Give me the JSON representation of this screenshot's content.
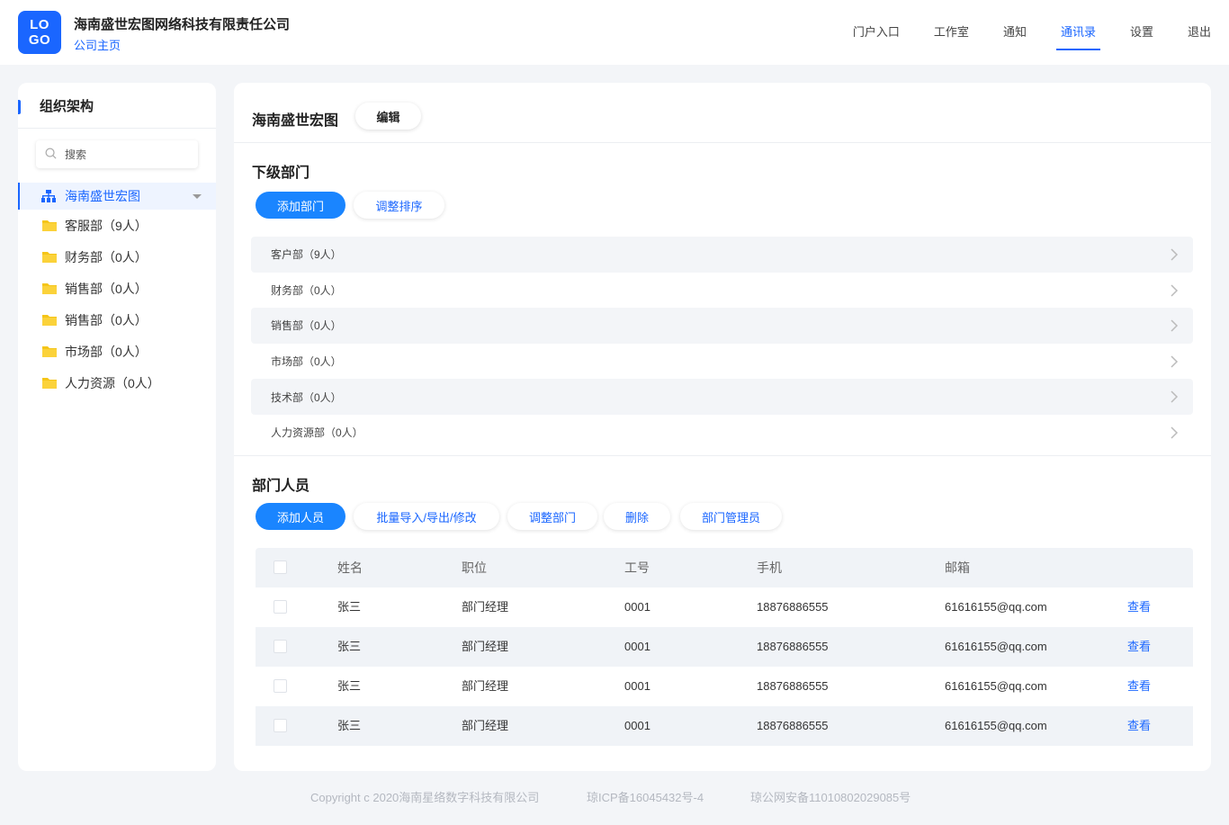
{
  "header": {
    "logo_line1": "LO",
    "logo_line2": "GO",
    "company_name": "海南盛世宏图网络科技有限责任公司",
    "company_home": "公司主页",
    "nav": [
      "门户入口",
      "工作室",
      "通知",
      "通讯录",
      "设置",
      "退出"
    ],
    "active_nav": "通讯录"
  },
  "sidebar": {
    "title": "组织架构",
    "search_placeholder": "搜索",
    "root": "海南盛世宏图",
    "items": [
      "客服部（9人）",
      "财务部（0人）",
      "销售部（0人）",
      "销售部（0人）",
      "市场部（0人）",
      "人力资源（0人）"
    ]
  },
  "main": {
    "title": "海南盛世宏图",
    "edit_label": "编辑",
    "sub_dept_title": "下级部门",
    "add_dept_label": "添加部门",
    "sort_label": "调整排序",
    "departments": [
      "客户部（9人）",
      "财务部（0人）",
      "销售部（0人）",
      "市场部（0人）",
      "技术部（0人）",
      "人力资源部（0人）"
    ],
    "members_title": "部门人员",
    "member_actions": [
      "添加人员",
      "批量导入/导出/修改",
      "调整部门",
      "删除",
      "部门管理员"
    ],
    "table": {
      "columns": [
        "姓名",
        "职位",
        "工号",
        "手机",
        "邮箱"
      ],
      "view_label": "查看",
      "rows": [
        {
          "name": "张三",
          "position": "部门经理",
          "id": "0001",
          "phone": "18876886555",
          "email": "61616155@qq.com"
        },
        {
          "name": "张三",
          "position": "部门经理",
          "id": "0001",
          "phone": "18876886555",
          "email": "61616155@qq.com"
        },
        {
          "name": "张三",
          "position": "部门经理",
          "id": "0001",
          "phone": "18876886555",
          "email": "61616155@qq.com"
        },
        {
          "name": "张三",
          "position": "部门经理",
          "id": "0001",
          "phone": "18876886555",
          "email": "61616155@qq.com"
        }
      ]
    }
  },
  "footer": {
    "copyright": "Copyright c 2020海南星络数字科技有限公司",
    "icp": "琼ICP备16045432号-4",
    "police": "琼公网安备11010802029085号"
  },
  "colors": {
    "accent": "#1a66ff",
    "primary_button": "#1a85ff",
    "folder": "#f5c518"
  }
}
